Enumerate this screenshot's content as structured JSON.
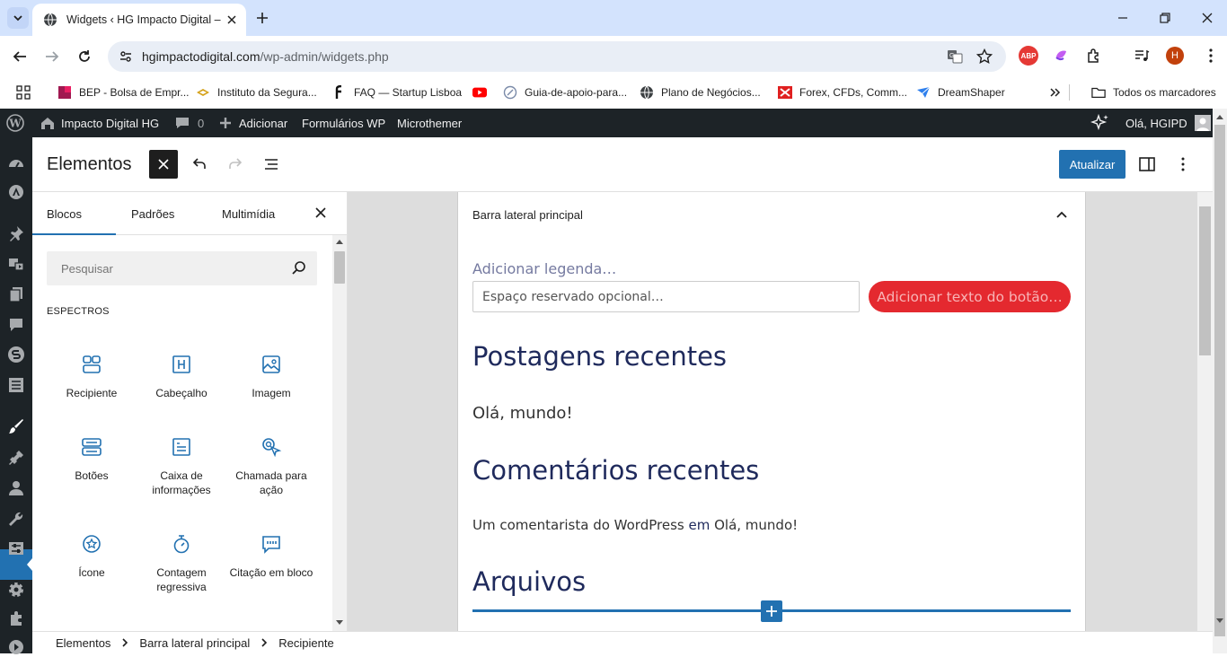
{
  "browser": {
    "tab_title": "Widgets ‹ HG Impacto Digital –",
    "url_host": "hgimpactodigital.com",
    "url_path": "/wp-admin/widgets.php",
    "profile_initial": "H",
    "abp_label": "ABP",
    "bookmarks": [
      {
        "label": "BEP - Bolsa de Empr...",
        "icon": "bep-icon"
      },
      {
        "label": "Instituto da Segura...",
        "icon": "instituto-icon"
      },
      {
        "label": "FAQ — Startup Lisboa",
        "icon": "startup-lisboa-icon"
      },
      {
        "label": "",
        "icon": "youtube-icon"
      },
      {
        "label": "Guia-de-apoio-para...",
        "icon": "guia-icon"
      },
      {
        "label": "Plano de Negócios...",
        "icon": "globe-icon"
      },
      {
        "label": "Forex, CFDs, Comm...",
        "icon": "forex-icon"
      },
      {
        "label": "DreamShaper",
        "icon": "dreamshaper-icon"
      }
    ],
    "all_bookmarks": "Todos os marcadores"
  },
  "adminbar": {
    "site_name": "Impacto Digital HG",
    "comments_count": "0",
    "add_new": "Adicionar",
    "forms": "Formulários WP",
    "microthemer": "Microthemer",
    "greeting": "Olá, HGIPD"
  },
  "editor": {
    "title": "Elementos",
    "update_label": "Atualizar"
  },
  "inserter": {
    "tabs": [
      "Blocos",
      "Padrões",
      "Multimídia"
    ],
    "search_placeholder": "Pesquisar",
    "category": "ESPECTROS",
    "blocks": [
      {
        "label": "Recipiente",
        "icon": "container-icon"
      },
      {
        "label": "Cabeçalho",
        "icon": "heading-icon"
      },
      {
        "label": "Imagem",
        "icon": "image-icon"
      },
      {
        "label": "Botões",
        "icon": "buttons-icon"
      },
      {
        "label": "Caixa de informações",
        "icon": "info-box-icon"
      },
      {
        "label": "Chamada para ação",
        "icon": "call-to-action-icon"
      },
      {
        "label": "Ícone",
        "icon": "star-icon"
      },
      {
        "label": "Contagem regressiva",
        "icon": "stopwatch-icon"
      },
      {
        "label": "Citação em bloco",
        "icon": "quote-icon"
      }
    ]
  },
  "canvas": {
    "area_title": "Barra lateral principal",
    "caption": "Adicionar legenda…",
    "search_placeholder": "Espaço reservado opcional…",
    "search_button": "Adicionar texto do botão…",
    "recent_posts_heading": "Postagens recentes",
    "recent_post": "Olá, mundo!",
    "recent_comments_heading": "Comentários recentes",
    "comment_author": "Um comentarista do WordPress",
    "comment_em": "em",
    "comment_post": "Olá, mundo!",
    "archives_heading": "Arquivos"
  },
  "breadcrumbs": [
    "Elementos",
    "Barra lateral principal",
    "Recipiente"
  ],
  "colors": {
    "wp_blue": "#2271b1",
    "admin_dark": "#1d2327",
    "button_red": "#e4292f",
    "heading_navy": "#1f2a5c"
  }
}
